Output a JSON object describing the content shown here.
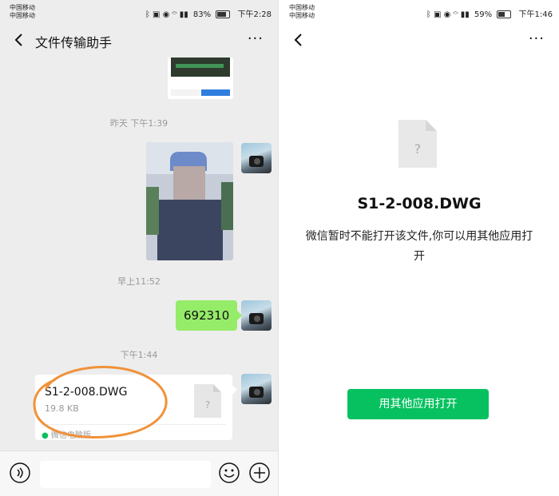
{
  "left": {
    "status": {
      "carrier1": "中国移动",
      "carrier2": "中国移动",
      "battery": "83%",
      "time": "下午2:28",
      "battery_fill": 0.83
    },
    "header": {
      "title": "文件传输助手",
      "more": "···"
    },
    "messages": {
      "ts1": "昨天 下午1:39",
      "ts2": "早上11:52",
      "text_msg": "692310",
      "ts3": "下午1:44",
      "file": {
        "name": "S1-2-008.DWG",
        "size": "19.8 KB",
        "source": "微信电脑版",
        "icon_mark": "?"
      }
    },
    "colors": {
      "bubble_green": "#95ec69",
      "annotation_orange": "#f0923a"
    }
  },
  "right": {
    "status": {
      "carrier1": "中国移动",
      "carrier2": "中国移动",
      "battery": "59%",
      "time": "下午1:46",
      "battery_fill": 0.59
    },
    "header": {
      "more": "···"
    },
    "file_name": "S1-2-008.DWG",
    "icon_mark": "?",
    "message": "微信暂时不能打开该文件,你可以用其他应用打开",
    "open_button": "用其他应用打开",
    "colors": {
      "button_green": "#07c160"
    }
  }
}
